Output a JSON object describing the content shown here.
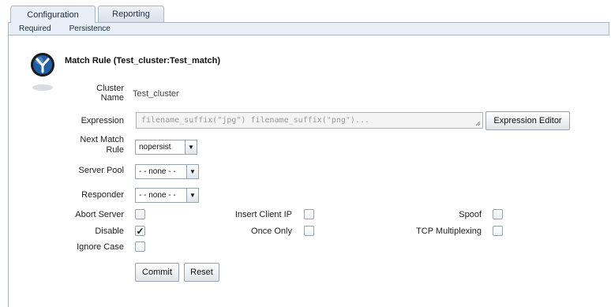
{
  "tabs": [
    {
      "label": "Configuration"
    },
    {
      "label": "Reporting"
    }
  ],
  "subtabs": [
    {
      "label": "Required"
    },
    {
      "label": "Persistence"
    }
  ],
  "page_title": "Match Rule (Test_cluster:Test_match)",
  "cluster": {
    "label": "Cluster Name",
    "value": "Test_cluster"
  },
  "expression": {
    "label": "Expression",
    "value": "filename_suffix(\"jpg\") filename_suffix(\"png\")...",
    "editor_button": "Expression Editor"
  },
  "next_match_rule": {
    "label": "Next Match Rule",
    "value": "nopersist"
  },
  "server_pool": {
    "label": "Server Pool",
    "value": "- - none - -"
  },
  "responder": {
    "label": "Responder",
    "value": "- - none - -"
  },
  "options": {
    "abort_server": {
      "label": "Abort Server",
      "checked": false
    },
    "disable": {
      "label": "Disable",
      "checked": true
    },
    "ignore_case": {
      "label": "Ignore Case",
      "checked": false
    },
    "insert_client_ip": {
      "label": "Insert Client IP",
      "checked": false
    },
    "once_only": {
      "label": "Once Only",
      "checked": false
    },
    "spoof": {
      "label": "Spoof",
      "checked": false
    },
    "tcp_multiplexing": {
      "label": "TCP Multiplexing",
      "checked": false
    }
  },
  "checkmark": "✓",
  "actions": {
    "commit": "Commit",
    "reset": "Reset"
  },
  "icons": {
    "rule_icon": "match-rule-icon",
    "dropdown": "chevron-down-icon",
    "resize": "resize-grip-icon"
  },
  "colors": {
    "tab_active_bg": "#e7eef5",
    "border": "#a9b6c4",
    "icon_blue": "#1e5fa8"
  }
}
